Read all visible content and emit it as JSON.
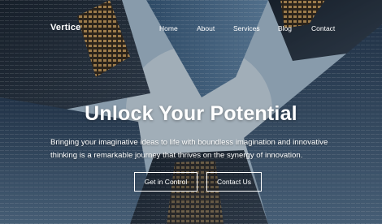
{
  "brand": "Vertice",
  "nav": {
    "items": [
      {
        "label": "Home"
      },
      {
        "label": "About"
      },
      {
        "label": "Services"
      },
      {
        "label": "Blog"
      },
      {
        "label": "Contact"
      }
    ]
  },
  "hero": {
    "headline": "Unlock Your Potential",
    "subtitle": "Bringing your imaginative ideas to life with boundless imagination and innovative thinking is a remarkable journey that thrives on the synergy of innovation.",
    "primary_cta": "Get in Control",
    "secondary_cta": "Contact Us"
  }
}
